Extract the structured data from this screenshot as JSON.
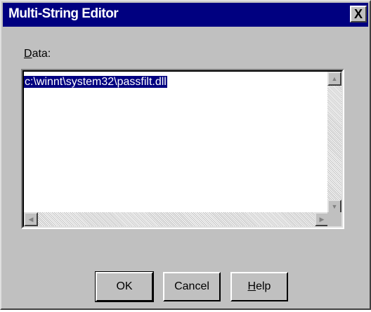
{
  "window": {
    "title": "Multi-String Editor",
    "close_glyph": "X"
  },
  "data_field": {
    "label_prefix": "D",
    "label_rest": "ata:",
    "lines": [
      "c:\\winnt\\system32\\passfilt.dll"
    ]
  },
  "scrollbars": {
    "up_arrow": "▲",
    "down_arrow": "▼",
    "left_arrow": "◀",
    "right_arrow": "▶"
  },
  "buttons": {
    "ok": "OK",
    "cancel": "Cancel",
    "help_prefix": "H",
    "help_rest": "elp"
  },
  "colors": {
    "titlebar": "#000080",
    "face": "#c0c0c0",
    "selection": "#000080"
  }
}
